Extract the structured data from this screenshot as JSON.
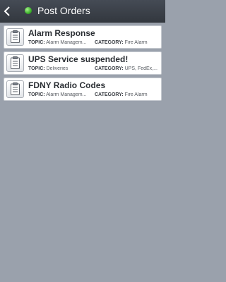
{
  "header": {
    "title": "Post Orders",
    "status_color": "#3cb22a",
    "back_icon": "chevron-left-icon"
  },
  "labels": {
    "topic": "TOPIC:",
    "category": "CATEGORY:"
  },
  "orders": [
    {
      "title": "Alarm Response",
      "topic": "Alarm Managem...",
      "category": "Fire Alarm",
      "icon": "clipboard-icon"
    },
    {
      "title": "UPS Service suspended!",
      "topic": "Deliveries",
      "category": "UPS, FedEx,...",
      "icon": "clipboard-icon"
    },
    {
      "title": "FDNY Radio Codes",
      "topic": "Alarm Managem...",
      "category": "Fire Alarm",
      "icon": "clipboard-icon"
    }
  ]
}
